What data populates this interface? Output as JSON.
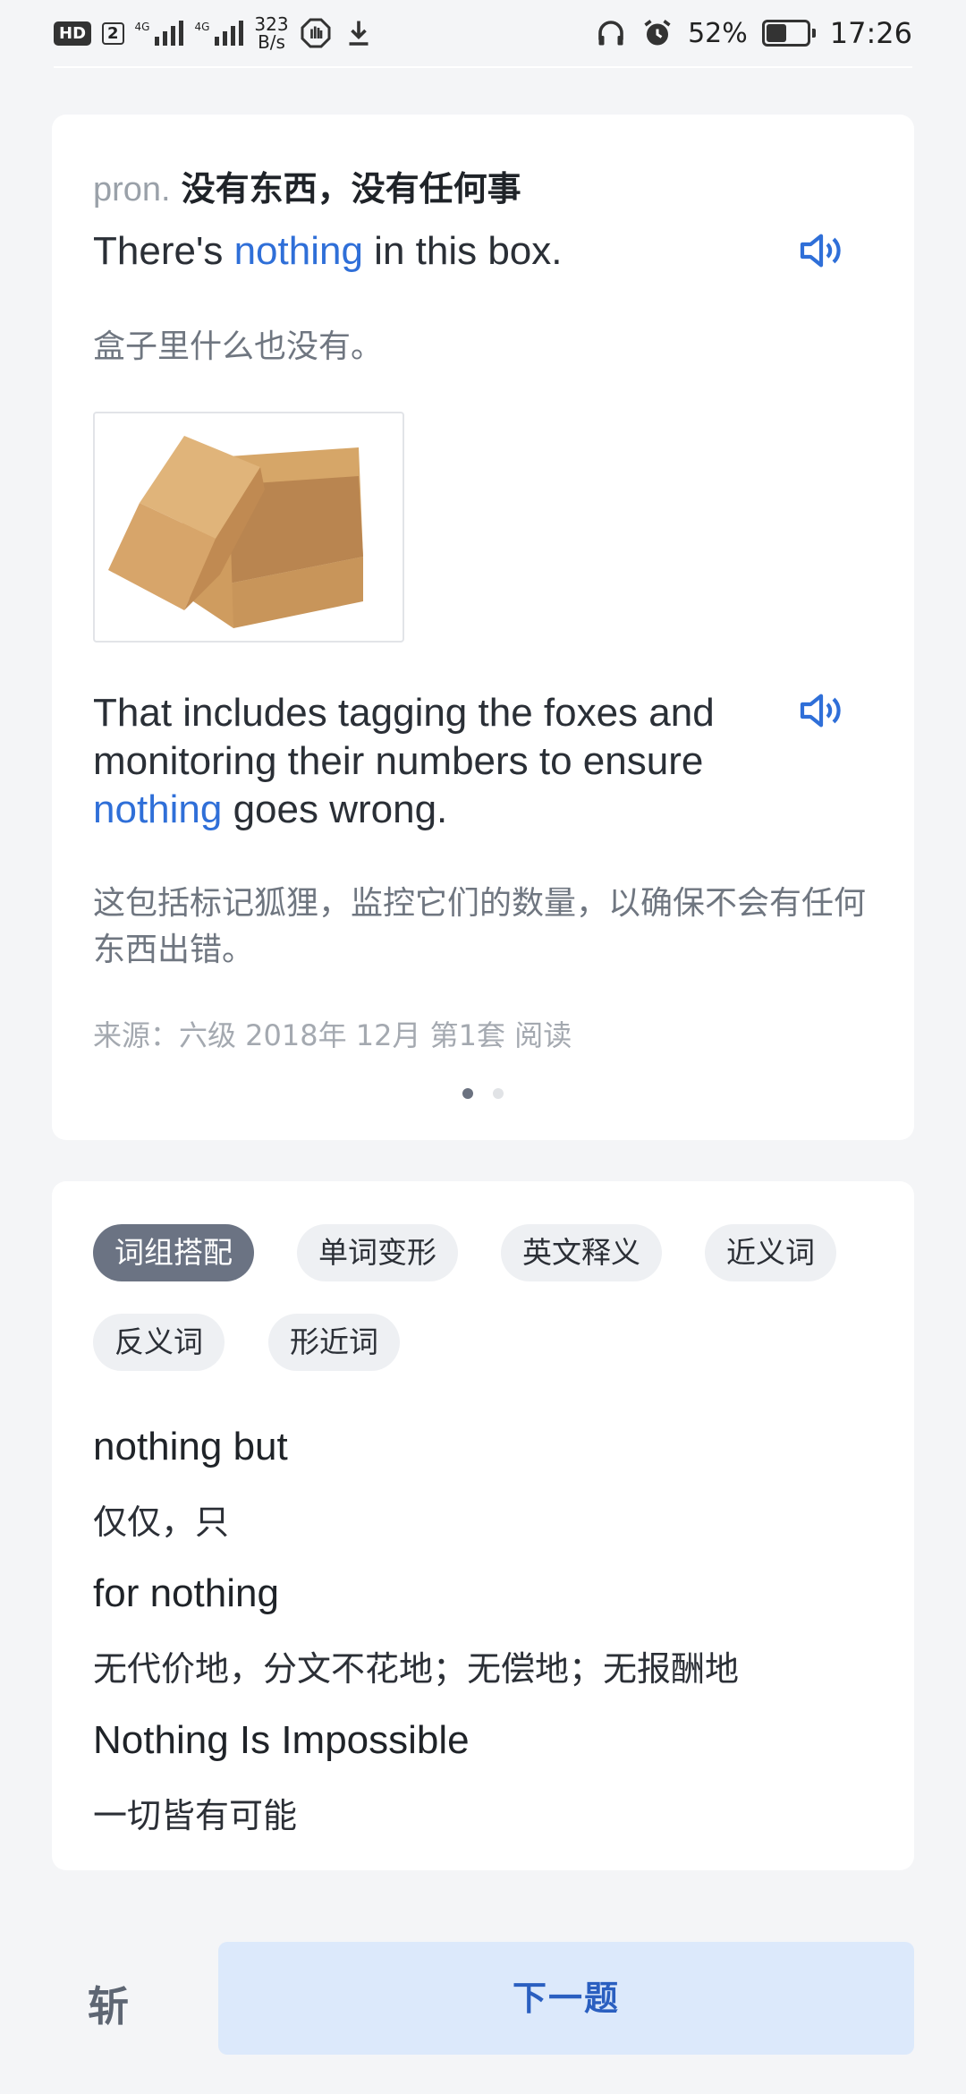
{
  "status_bar": {
    "hd": "HD",
    "sim": "2",
    "signal1": "4G",
    "signal2": "4G",
    "net_speed": "323",
    "net_unit": "B/s",
    "battery": "52%",
    "time": "17:26"
  },
  "definition": {
    "pos": "pron.",
    "meaning": "没有东西，没有任何事"
  },
  "example1": {
    "before": "There's ",
    "keyword": "nothing",
    "after": " in this box.",
    "translation": "盒子里什么也没有。"
  },
  "example2": {
    "before": "That includes tagging the foxes and monitoring their numbers to ensure ",
    "keyword": "nothing",
    "after": " goes wrong.",
    "translation": "这包括标记狐狸，监控它们的数量，以确保不会有任何东西出错。",
    "source": "来源：六级 2018年 12月 第1套 阅读"
  },
  "pager": {
    "total": 2,
    "current": 1
  },
  "tabs": [
    {
      "label": "词组搭配",
      "active": true
    },
    {
      "label": "单词变形",
      "active": false
    },
    {
      "label": "英文释义",
      "active": false
    },
    {
      "label": "近义词",
      "active": false
    },
    {
      "label": "反义词",
      "active": false
    },
    {
      "label": "形近词",
      "active": false
    }
  ],
  "phrases": [
    {
      "en": "nothing but",
      "zh": "仅仅，只"
    },
    {
      "en": "for nothing",
      "zh": "无代价地，分文不花地；无偿地；无报酬地"
    },
    {
      "en": "Nothing Is Impossible",
      "zh": "一切皆有可能"
    }
  ],
  "bottom": {
    "chop_label": "斩",
    "next_label": "下一题"
  },
  "colors": {
    "accent": "#2f6fd8",
    "active_chip": "#6b7383",
    "next_button_bg": "#dce9fb"
  }
}
